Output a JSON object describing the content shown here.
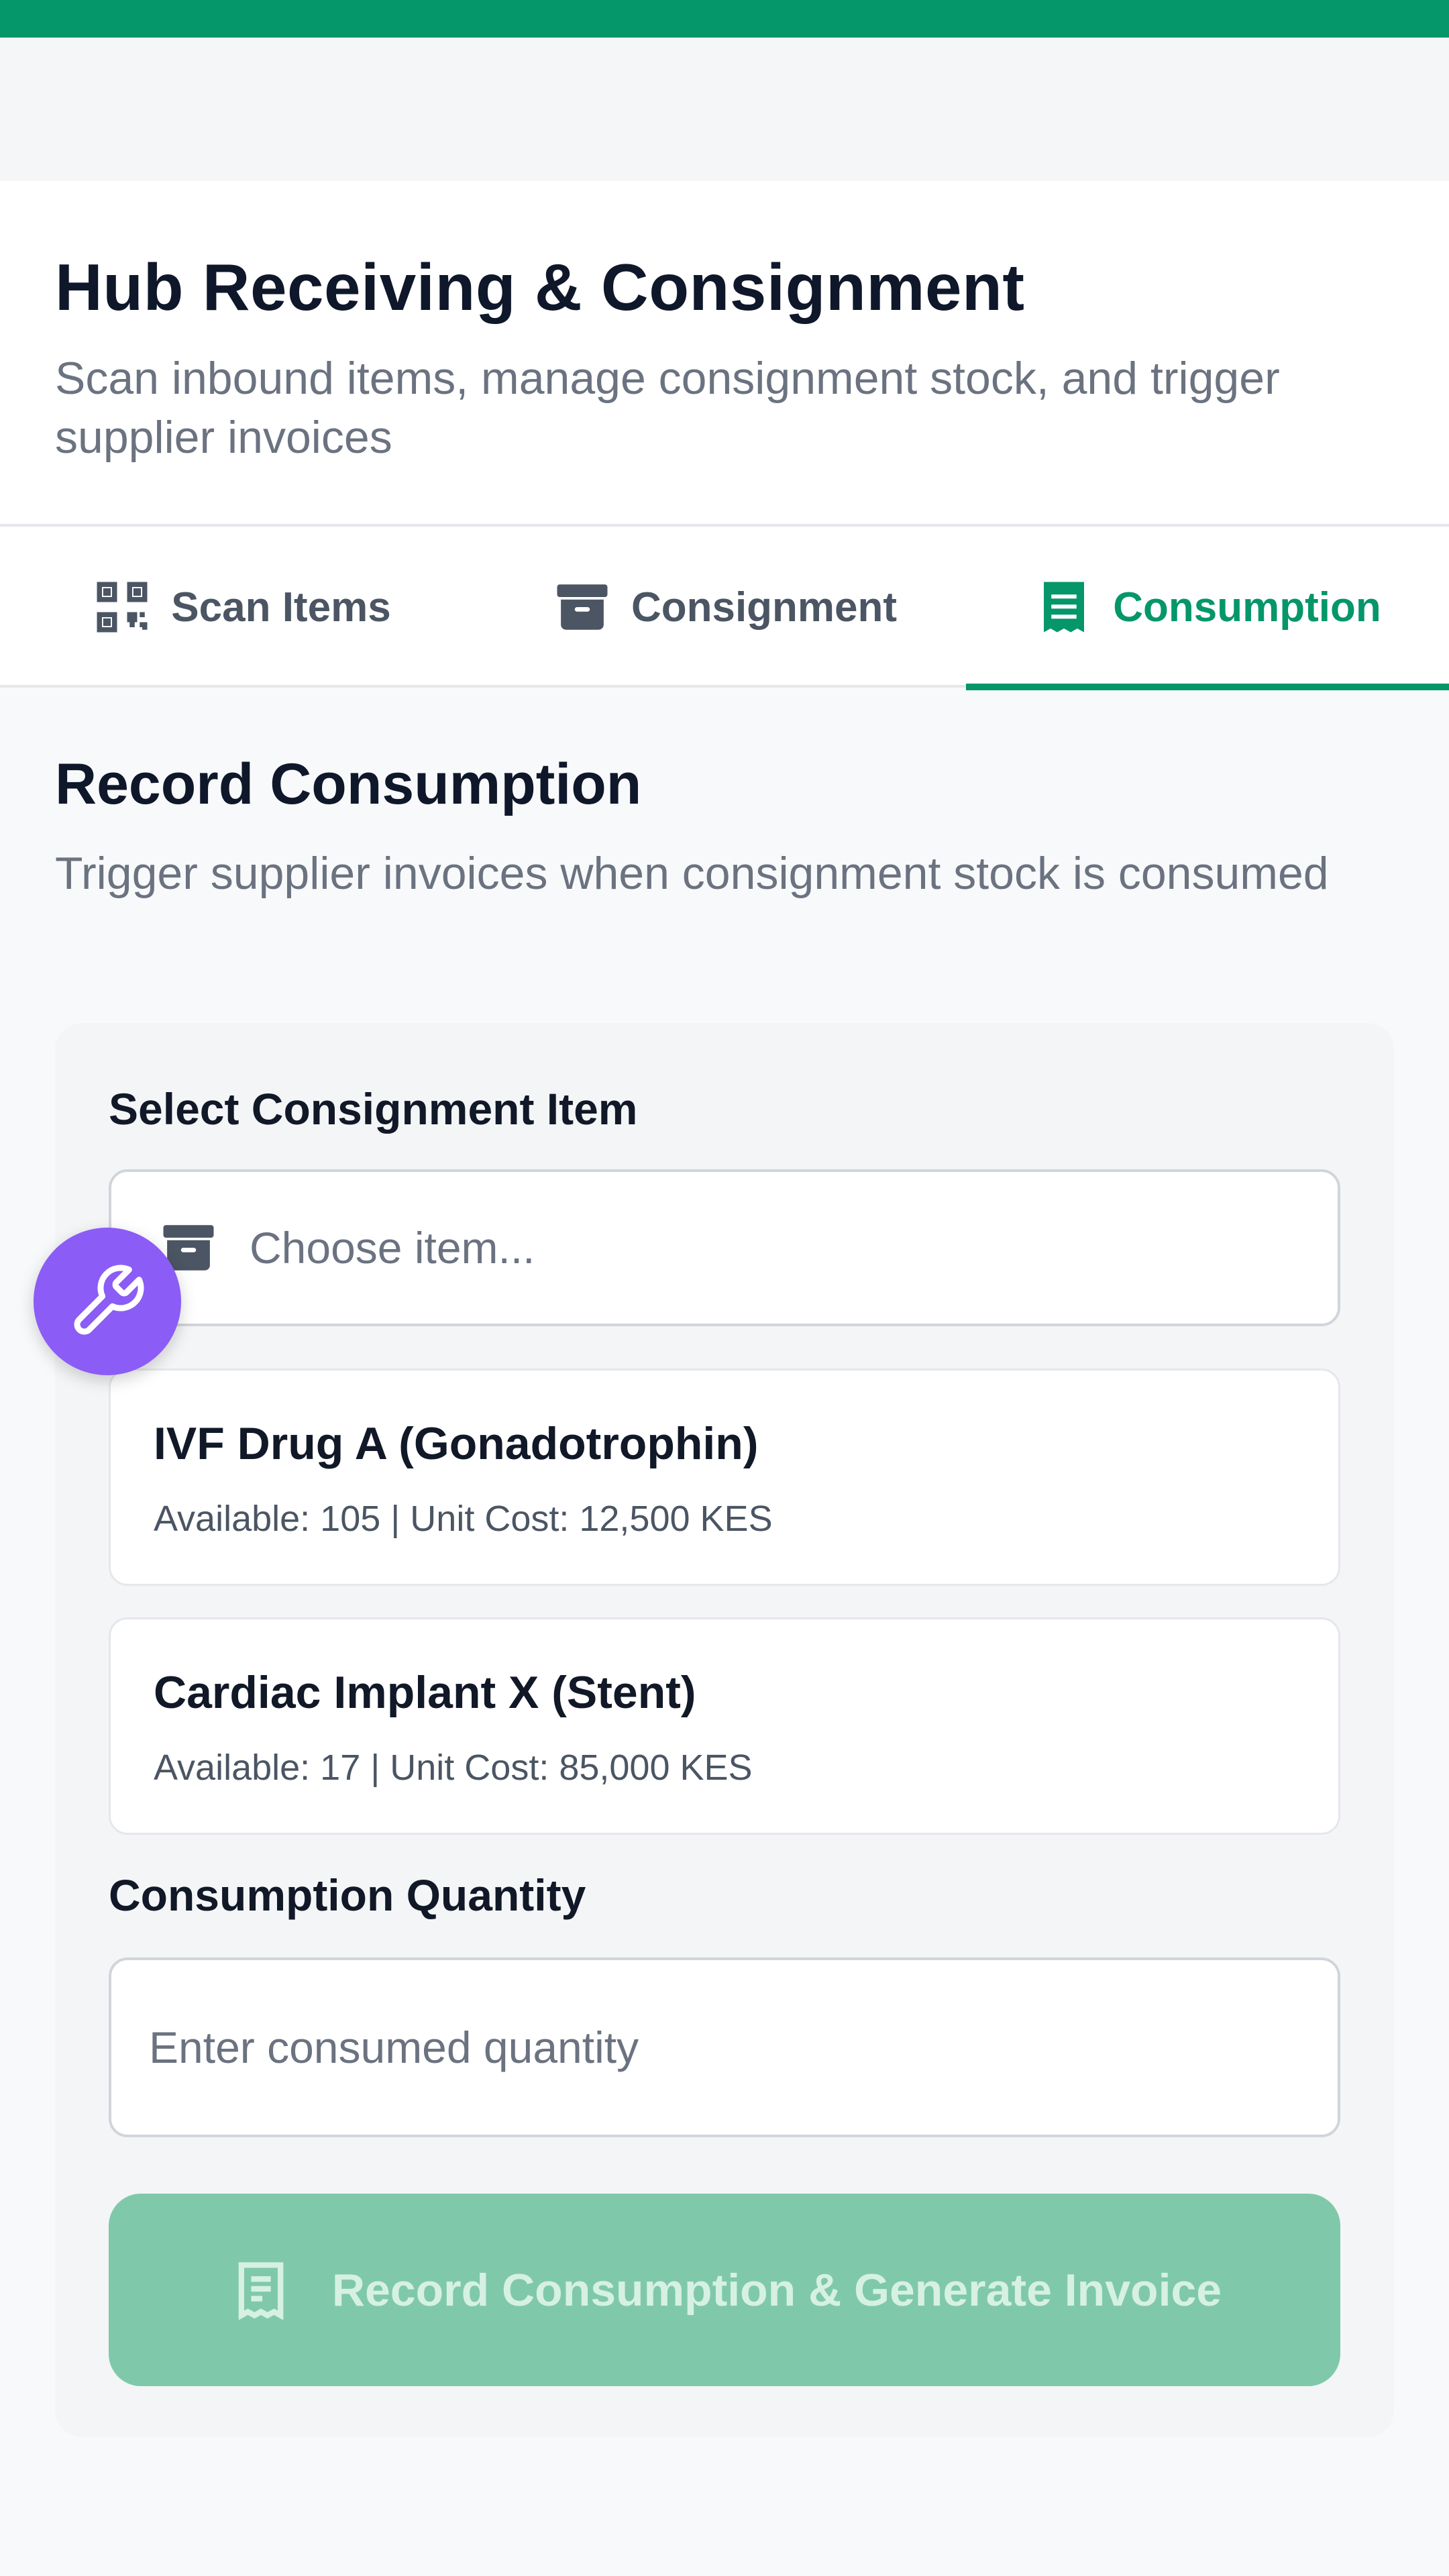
{
  "header": {
    "title": "Hub Receiving & Consignment",
    "subtitle": "Scan inbound items, manage consignment stock, and trigger supplier invoices"
  },
  "tabs": [
    {
      "label": "Scan Items",
      "icon": "qr-scan-icon",
      "active": false
    },
    {
      "label": "Consignment",
      "icon": "archive-box-icon",
      "active": false
    },
    {
      "label": "Consumption",
      "icon": "receipt-icon",
      "active": true
    }
  ],
  "section": {
    "title": "Record Consumption",
    "subtitle": "Trigger supplier invoices when consignment stock is consumed"
  },
  "form": {
    "item_label": "Select Consignment Item",
    "item_placeholder": "Choose item...",
    "options": [
      {
        "name": "IVF Drug A (Gonadotrophin)",
        "meta": "Available: 105 | Unit Cost: 12,500 KES"
      },
      {
        "name": "Cardiac Implant X (Stent)",
        "meta": "Available: 17 | Unit Cost: 85,000 KES"
      }
    ],
    "quantity_label": "Consumption Quantity",
    "quantity_placeholder": "Enter consumed quantity",
    "submit_label": "Record Consumption & Generate Invoice"
  },
  "colors": {
    "accent": "#059669",
    "fab": "#8b5cf6",
    "button_disabled": "#7fc9aa"
  },
  "fab": {
    "icon": "wrench-icon"
  }
}
